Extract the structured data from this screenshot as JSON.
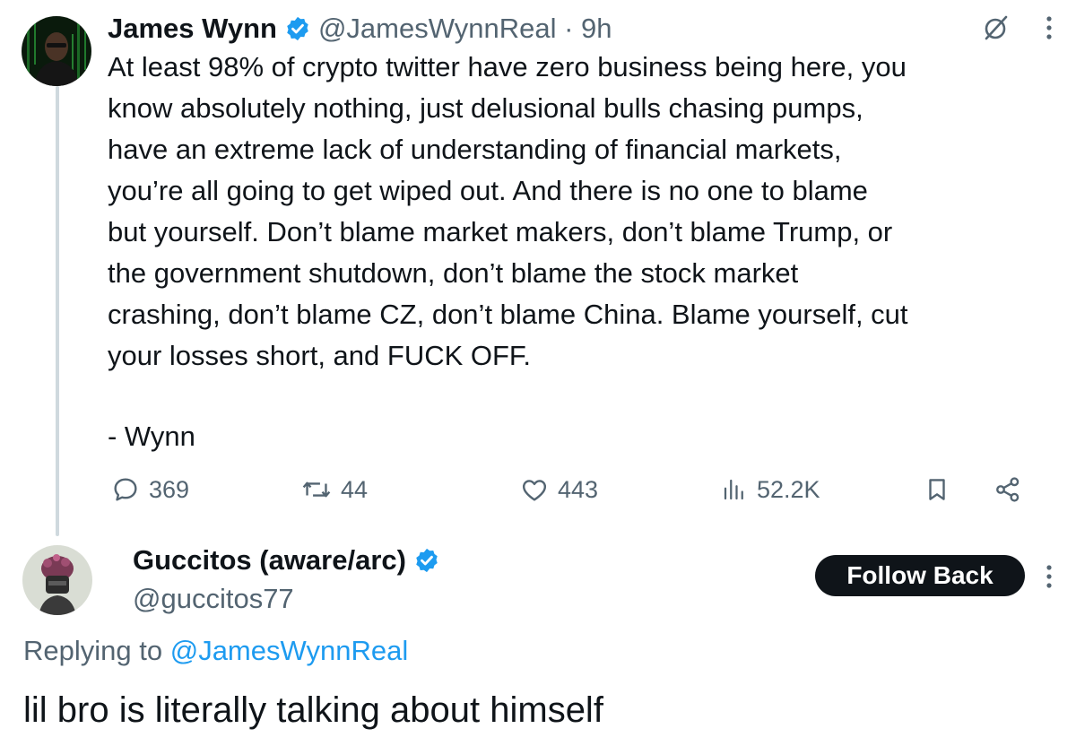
{
  "original_tweet": {
    "author_name": "James Wynn",
    "handle_time": "@JamesWynnReal · 9h",
    "body": "At least 98% of crypto twitter have zero business being here, you\nknow absolutely nothing, just delusional bulls chasing pumps,\nhave an extreme lack of understanding of financial markets,\nyou’re all going to get wiped out. And there is no one to blame\nbut yourself. Don’t blame market makers, don’t blame Trump, or\nthe government shutdown, don’t blame the stock market\ncrashing, don’t blame CZ, don’t blame China. Blame yourself, cut\nyour losses short, and FUCK OFF.",
    "signature": "- Wynn",
    "stats": {
      "replies": "369",
      "reposts": "44",
      "likes": "443",
      "views": "52.2K"
    }
  },
  "reply": {
    "author_name": "Guccitos (aware/arc)",
    "handle": "@guccitos77",
    "follow_button_label": "Follow Back",
    "replying_to_prefix": "Replying to ",
    "replying_to_handle": "@JamesWynnReal",
    "text": "lil bro is literally talking about himself"
  },
  "icons": {
    "verified": "verified-badge-icon",
    "grok": "grok-icon",
    "more": "more-vertical-icon",
    "reply": "reply-bubble-icon",
    "repost": "repost-icon",
    "like": "heart-icon",
    "views": "views-bars-icon",
    "bookmark": "bookmark-icon",
    "share": "share-icon"
  },
  "colors": {
    "text_primary": "#0f1419",
    "text_secondary": "#536471",
    "verified_blue": "#1d9bf0",
    "link_blue": "#1d9bf0",
    "button_dark": "#0f1419",
    "thread_line": "#cfd9de"
  }
}
